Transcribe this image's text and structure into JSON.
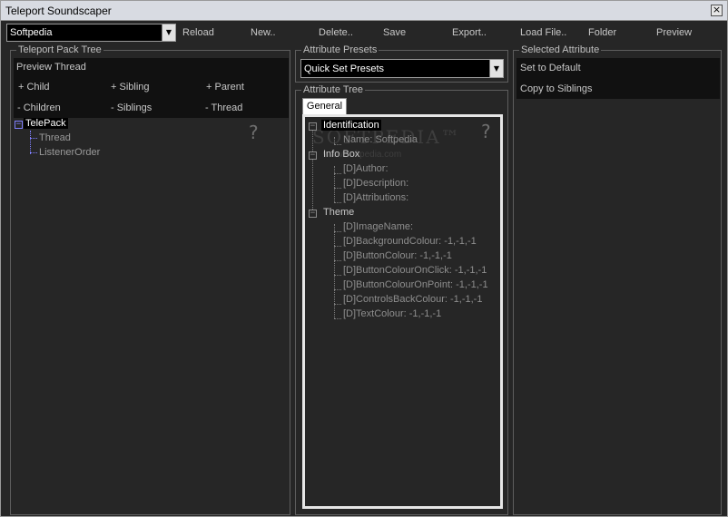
{
  "window": {
    "title": "Teleport Soundscaper",
    "close_glyph": "×"
  },
  "toolbar": {
    "pack_select_value": "Softpedia",
    "buttons": [
      "Reload",
      "New..",
      "Delete..",
      "Save",
      "Export..",
      "Load File..",
      "Folder",
      "Preview"
    ]
  },
  "left_panel": {
    "legend": "Teleport Pack Tree",
    "preview_thread": "Preview Thread",
    "add_child": "+ Child",
    "add_sibling": "+ Sibling",
    "add_parent": "+ Parent",
    "remove_children": "- Children",
    "remove_siblings": "- Siblings",
    "remove_thread": "- Thread",
    "help": "?",
    "tree": {
      "root": "TelePack",
      "children": [
        "Thread",
        "ListenerOrder"
      ]
    }
  },
  "presets": {
    "legend": "Attribute Presets",
    "value": "Quick Set Presets"
  },
  "attribute_tree": {
    "legend": "Attribute Tree",
    "tab": "General",
    "help": "?",
    "watermark": "SOFTPEDIA™",
    "watermark_sub": "www.softpedia.com",
    "groups": [
      {
        "name": "Identification",
        "items": [
          "Name: Softpedia"
        ]
      },
      {
        "name": "Info Box",
        "items": [
          "[D]Author:",
          "[D]Description:",
          "[D]Attributions:"
        ]
      },
      {
        "name": "Theme",
        "items": [
          "[D]ImageName:",
          "[D]BackgroundColour: -1,-1,-1",
          "[D]ButtonColour: -1,-1,-1",
          "[D]ButtonColourOnClick: -1,-1,-1",
          "[D]ButtonColourOnPoint: -1,-1,-1",
          "[D]ControlsBackColour: -1,-1,-1",
          "[D]TextColour: -1,-1,-1"
        ]
      }
    ]
  },
  "right_panel": {
    "legend": "Selected Attribute",
    "set_default": "Set to Default",
    "copy_siblings": "Copy to Siblings"
  },
  "icons": {
    "dropdown": "chevron-down-icon",
    "expander": "minus-box-icon"
  },
  "colors": {
    "background": "#262626",
    "selection": "#000000",
    "tree_lines": "#8080ff"
  }
}
